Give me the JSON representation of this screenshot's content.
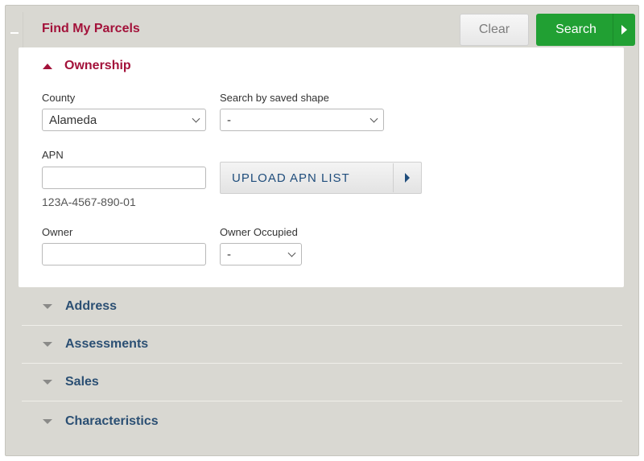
{
  "header": {
    "title": "Find My Parcels",
    "clear_label": "Clear",
    "search_label": "Search"
  },
  "ownership": {
    "title": "Ownership",
    "county": {
      "label": "County",
      "value": "Alameda"
    },
    "saved_shape": {
      "label": "Search by saved shape",
      "value": "-"
    },
    "apn": {
      "label": "APN",
      "value": "",
      "hint": "123A-4567-890-01"
    },
    "upload_label": "UPLOAD APN LIST",
    "owner": {
      "label": "Owner",
      "value": ""
    },
    "owner_occupied": {
      "label": "Owner Occupied",
      "value": "-"
    }
  },
  "sections": [
    {
      "title": "Address"
    },
    {
      "title": "Assessments"
    },
    {
      "title": "Sales"
    },
    {
      "title": "Characteristics"
    }
  ],
  "colors": {
    "brand_red": "#a3123a",
    "search_green": "#21a033",
    "section_blue": "#2b4f73",
    "panel_bg": "#d9d8d2"
  }
}
